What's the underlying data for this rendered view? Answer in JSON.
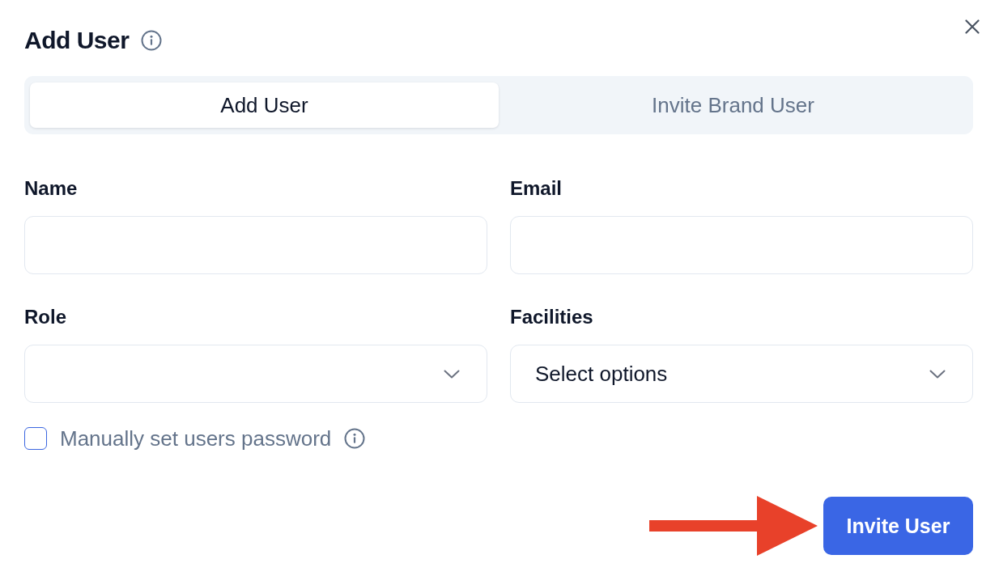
{
  "dialog": {
    "title": "Add User"
  },
  "tabs": [
    {
      "label": "Add User",
      "selected": true
    },
    {
      "label": "Invite Brand User",
      "selected": false
    }
  ],
  "fields": [
    {
      "label": "Name",
      "kind": "text"
    },
    {
      "label": "Email",
      "kind": "text"
    },
    {
      "label": "Role",
      "kind": "select"
    },
    {
      "label": "Facilities",
      "kind": "select",
      "placeholder": "Select options"
    }
  ],
  "password_option": {
    "label": "Manually set users password",
    "checked": false
  },
  "submit_button": {
    "label": "Invite User"
  }
}
